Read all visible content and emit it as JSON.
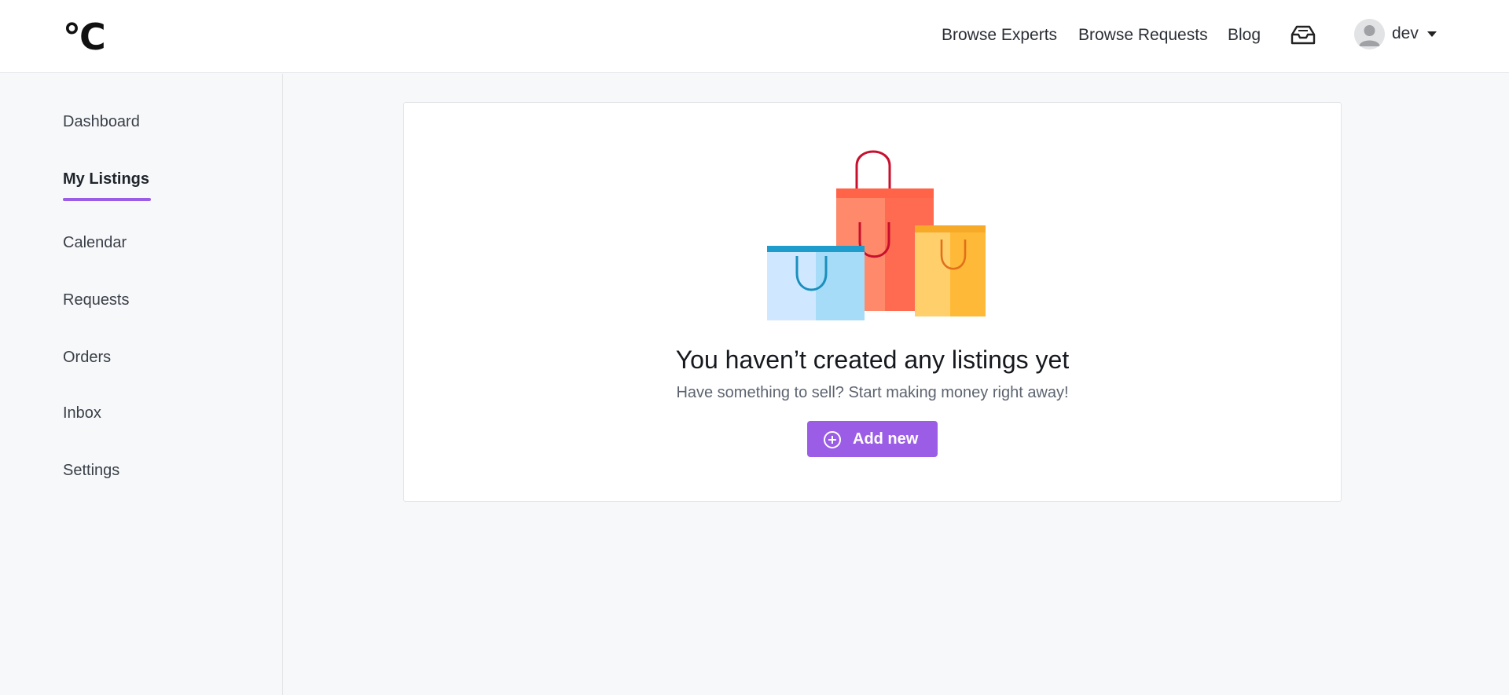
{
  "header": {
    "logo": "°C",
    "nav": {
      "browse_experts": "Browse Experts",
      "browse_requests": "Browse Requests",
      "blog": "Blog"
    },
    "inbox_icon": "inbox-tray-icon",
    "user": {
      "name": "dev",
      "avatar_icon": "user-avatar-icon"
    }
  },
  "sidebar": {
    "items": [
      {
        "label": "Dashboard",
        "active": false
      },
      {
        "label": "My Listings",
        "active": true
      },
      {
        "label": "Calendar",
        "active": false
      },
      {
        "label": "Requests",
        "active": false
      },
      {
        "label": "Orders",
        "active": false
      },
      {
        "label": "Inbox",
        "active": false
      },
      {
        "label": "Settings",
        "active": false
      }
    ]
  },
  "main": {
    "empty_state": {
      "illustration": "shopping-bags-illustration",
      "title": "You haven’t created any listings yet",
      "subtitle": "Have something to sell? Start making money right away!",
      "button_label": "Add new",
      "button_icon": "plus-circle-icon"
    }
  },
  "colors": {
    "accent": "#9b5de5",
    "background": "#f7f8fa",
    "card": "#ffffff"
  }
}
